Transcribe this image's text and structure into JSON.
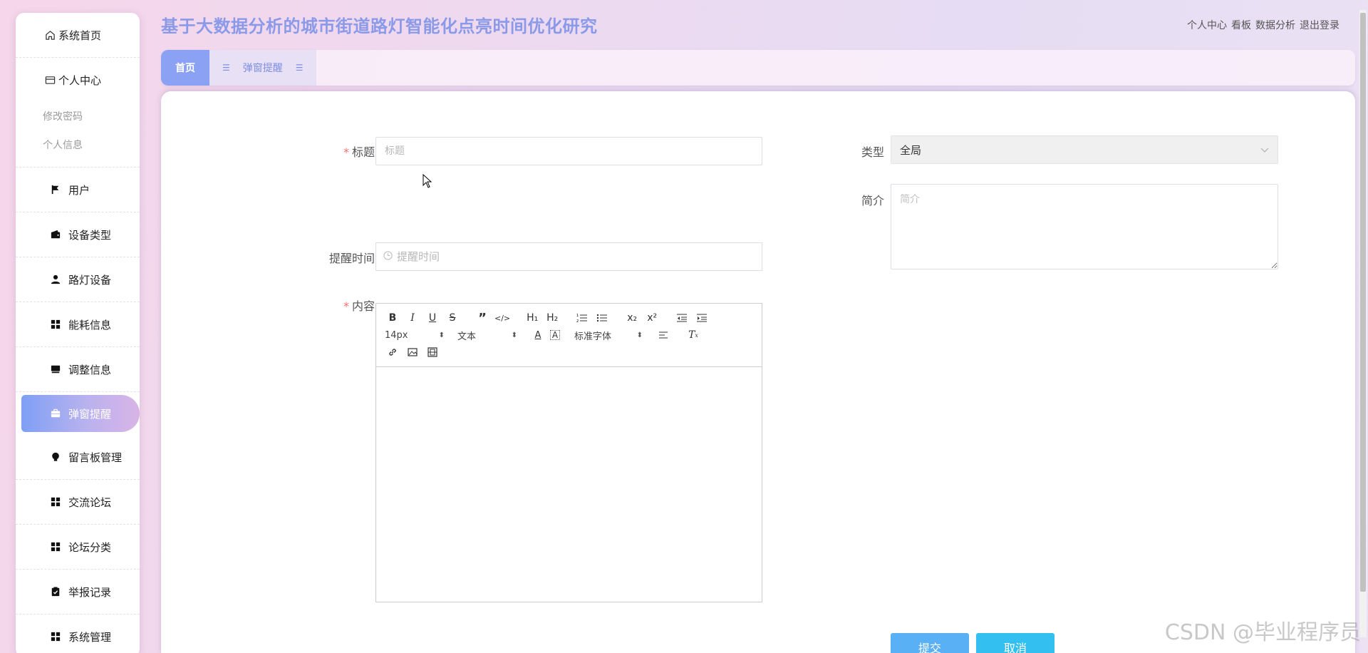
{
  "app_title": "基于大数据分析的城市街道路灯智能化点亮时间优化研究",
  "top_links": [
    "个人中心",
    "看板",
    "数据分析",
    "退出登录"
  ],
  "sidebar": {
    "home": {
      "label": "系统首页",
      "icon": "home-icon"
    },
    "personal": {
      "label": "个人中心",
      "icon": "card-icon",
      "children": [
        "修改密码",
        "个人信息"
      ]
    },
    "items": [
      {
        "label": "用户",
        "icon": "flag-icon"
      },
      {
        "label": "设备类型",
        "icon": "wallet-icon"
      },
      {
        "label": "路灯设备",
        "icon": "user-icon"
      },
      {
        "label": "能耗信息",
        "icon": "grid-icon"
      },
      {
        "label": "调整信息",
        "icon": "monitor-icon"
      },
      {
        "label": "弹窗提醒",
        "icon": "briefcase-icon",
        "active": true
      },
      {
        "label": "留言板管理",
        "icon": "bulb-icon"
      },
      {
        "label": "交流论坛",
        "icon": "grid-icon"
      },
      {
        "label": "论坛分类",
        "icon": "grid-icon"
      },
      {
        "label": "举报记录",
        "icon": "clipboard-icon"
      },
      {
        "label": "系统管理",
        "icon": "grid-icon"
      }
    ]
  },
  "tabs": {
    "home": "首页",
    "current": "弹窗提醒"
  },
  "form": {
    "title_label": "标题",
    "title_placeholder": "标题",
    "type_label": "类型",
    "type_value": "全局",
    "intro_label": "简介",
    "intro_placeholder": "简介",
    "remind_time_label": "提醒时间",
    "remind_time_placeholder": "提醒时间",
    "content_label": "内容",
    "submit": "提交",
    "cancel": "取消"
  },
  "editor": {
    "font_size": "14px",
    "block_format": "文本",
    "font_family": "标准字体",
    "h1": "H₁",
    "h2": "H₂",
    "sub": "x₂",
    "sup": "x²"
  },
  "watermark": "CSDN @毕业程序员",
  "colors": {
    "accent": "#8a9ae8",
    "submit": "#5ab0f5",
    "cancel": "#33c0f0",
    "required": "#f56c6c"
  }
}
